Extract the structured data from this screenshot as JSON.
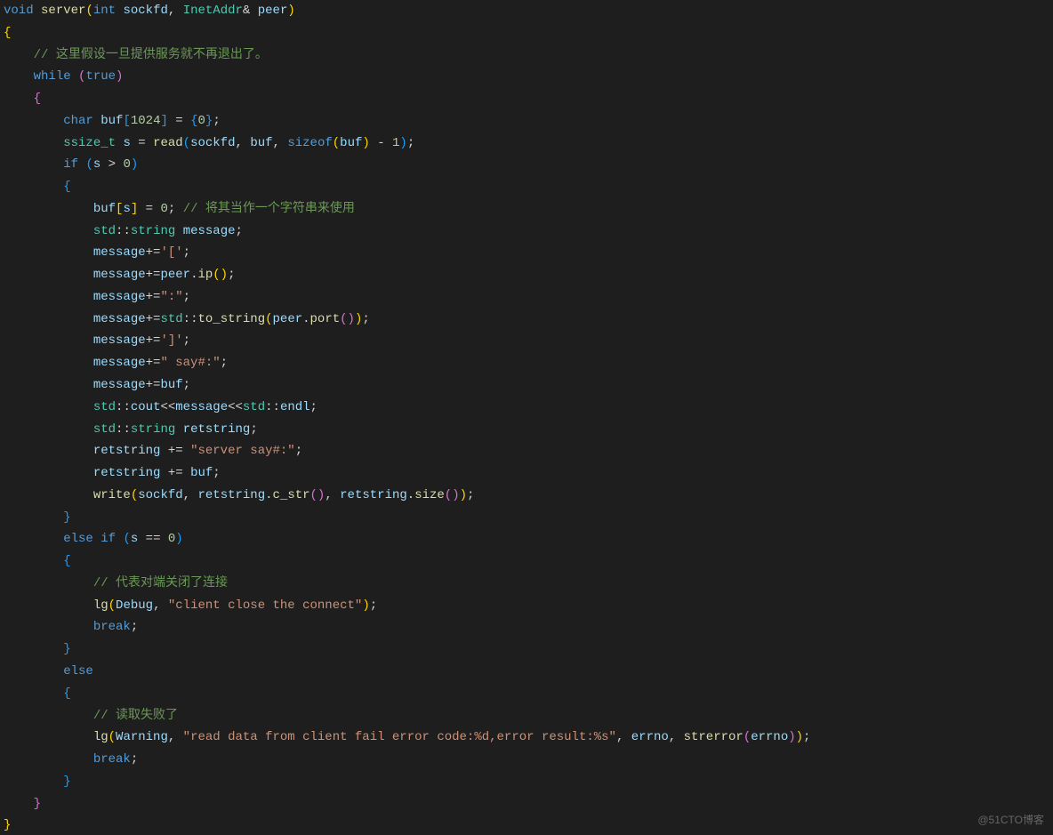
{
  "watermark": "@51CTO博客",
  "code": {
    "l1": {
      "a": "void",
      "b": "server",
      "c": "int",
      "d": "sockfd",
      "e": "InetAddr",
      "f": "peer"
    },
    "l2": "{",
    "l4": "// 这里假设一旦提供服务就不再退出了。",
    "l5": {
      "a": "while",
      "b": "true"
    },
    "l6": "{",
    "l8": {
      "a": "char",
      "b": "buf",
      "c": "1024",
      "d": "0"
    },
    "l9": {
      "a": "ssize_t",
      "b": "s",
      "c": "read",
      "d": "sockfd",
      "e": "buf",
      "f": "sizeof",
      "g": "buf",
      "h": "1"
    },
    "l10": {
      "a": "if",
      "b": "s",
      "c": "0"
    },
    "l12": {
      "a": "buf",
      "b": "s",
      "c": "0",
      "d": "// 将其当作一个字符串来使用"
    },
    "l13": {
      "a": "std",
      "b": "string",
      "c": "message"
    },
    "l14": {
      "a": "message",
      "b": "'['"
    },
    "l15": {
      "a": "message",
      "b": "peer",
      "c": "ip"
    },
    "l16": {
      "a": "message",
      "b": "\":\""
    },
    "l17": {
      "a": "message",
      "b": "std",
      "c": "to_string",
      "d": "peer",
      "e": "port"
    },
    "l18": {
      "a": "message",
      "b": "']'"
    },
    "l19": {
      "a": "message",
      "b": "\" say#:\""
    },
    "l20": {
      "a": "message",
      "b": "buf"
    },
    "l21": {
      "a": "std",
      "b": "cout",
      "c": "message",
      "d": "std",
      "e": "endl"
    },
    "l22": {
      "a": "std",
      "b": "string",
      "c": "retstring"
    },
    "l23": {
      "a": "retstring",
      "b": "\"server say#:\""
    },
    "l24": {
      "a": "retstring",
      "b": "buf"
    },
    "l25": {
      "a": "write",
      "b": "sockfd",
      "c": "retstring",
      "d": "c_str",
      "e": "retstring",
      "f": "size"
    },
    "l27": {
      "a": "else",
      "b": "if",
      "c": "s",
      "d": "0"
    },
    "l29": "// 代表对端关闭了连接",
    "l30": {
      "a": "lg",
      "b": "Debug",
      "c": "\"client close the connect\""
    },
    "l31": "break",
    "l33": "else",
    "l35": "// 读取失败了",
    "l36": {
      "a": "lg",
      "b": "Warning",
      "c": "\"read data from client fail error code:%d,error result:%s\"",
      "d": "errno",
      "e": "strerror",
      "f": "errno"
    },
    "l37": "break"
  }
}
